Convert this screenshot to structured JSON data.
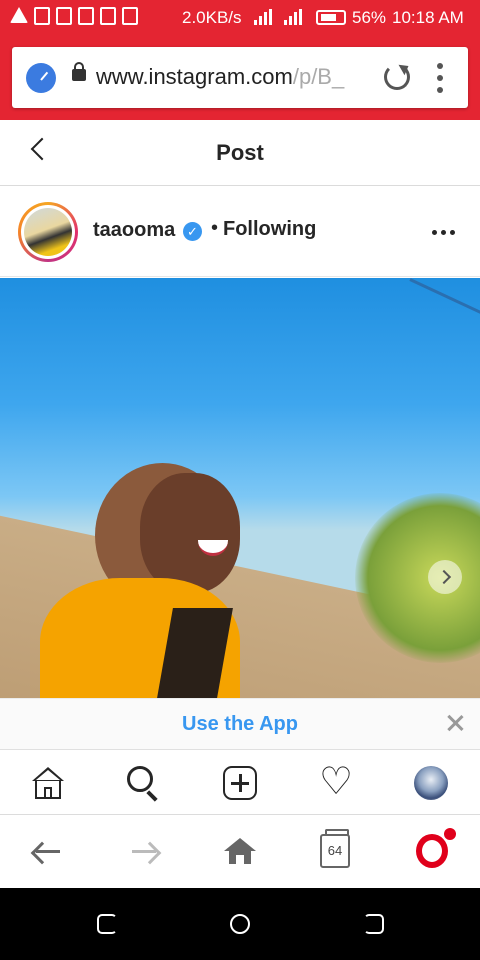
{
  "status_bar": {
    "network_speed": "2.0KB/s",
    "battery_percent": "56%",
    "time": "10:18 AM"
  },
  "browser": {
    "url_main": "www.instagram.com",
    "url_dim": "/p/B_",
    "tab_count": "64"
  },
  "header": {
    "back_icon": "chevron-left-icon",
    "title": "Post"
  },
  "post": {
    "username": "taaooma",
    "verified": true,
    "separator": "•",
    "follow_state": "Following",
    "more_icon": "more-horizontal-icon"
  },
  "banner": {
    "label": "Use the App",
    "close_icon": "close-icon"
  },
  "ig_nav": {
    "items": [
      "home-icon",
      "search-icon",
      "new-post-icon",
      "activity-heart-icon",
      "profile-avatar"
    ]
  },
  "browser_nav": {
    "items": [
      "back-arrow-icon",
      "forward-arrow-icon",
      "home-icon",
      "tabs-icon",
      "opera-menu-icon"
    ]
  },
  "colors": {
    "status_bar": "#e42532",
    "link_blue": "#3897f0",
    "opera_red": "#e0001b"
  }
}
